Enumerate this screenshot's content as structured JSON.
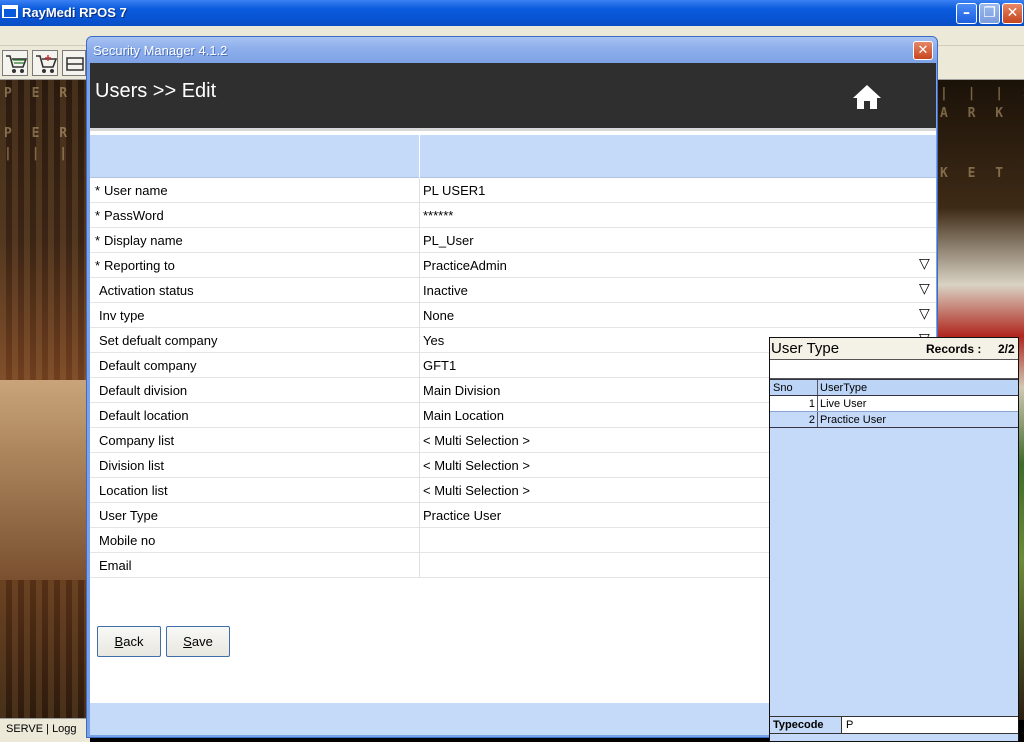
{
  "outer_window": {
    "title": "RayMedi RPOS 7",
    "status_text": "SERVE |  Logg"
  },
  "background": {
    "signage_text": [
      "P E R M A",
      "P E R M A",
      "| | | S U",
      "| | | S U P",
      "A R K E T",
      "K E T"
    ]
  },
  "dialog": {
    "title": "Security Manager 4.1.2",
    "breadcrumb": "Users >> Edit",
    "fields": [
      {
        "label": "User name",
        "value": "PL USER1",
        "required": true,
        "dropdown": false
      },
      {
        "label": "PassWord",
        "value": "******",
        "required": true,
        "dropdown": false
      },
      {
        "label": "Display name",
        "value": "PL_User",
        "required": true,
        "dropdown": false
      },
      {
        "label": "Reporting to",
        "value": "PracticeAdmin",
        "required": true,
        "dropdown": true
      },
      {
        "label": "Activation status",
        "value": "Inactive",
        "required": false,
        "dropdown": true
      },
      {
        "label": "Inv type",
        "value": "None",
        "required": false,
        "dropdown": true
      },
      {
        "label": "Set defualt company",
        "value": "Yes",
        "required": false,
        "dropdown": true
      },
      {
        "label": "Default company",
        "value": "GFT1",
        "required": false,
        "dropdown": false
      },
      {
        "label": "Default division",
        "value": "Main Division",
        "required": false,
        "dropdown": false
      },
      {
        "label": "Default location",
        "value": "Main Location",
        "required": false,
        "dropdown": false
      },
      {
        "label": "Company list",
        "value": "< Multi Selection >",
        "required": false,
        "dropdown": false
      },
      {
        "label": "Division list",
        "value": "< Multi Selection >",
        "required": false,
        "dropdown": false
      },
      {
        "label": "Location list",
        "value": "< Multi Selection >",
        "required": false,
        "dropdown": false
      },
      {
        "label": "User Type",
        "value": "Practice User",
        "required": false,
        "dropdown": false
      },
      {
        "label": "Mobile no",
        "value": "",
        "required": false,
        "dropdown": false
      },
      {
        "label": "Email",
        "value": "",
        "required": false,
        "dropdown": false
      }
    ],
    "required_marker": "*",
    "dropdown_glyph": "▽",
    "back_button": {
      "mnemonic": "B",
      "rest": "ack"
    },
    "save_button": {
      "mnemonic": "S",
      "rest": "ave"
    },
    "close_glyph": "✕"
  },
  "lookup": {
    "title": "User Type",
    "records_label": "Records :",
    "records_value": "2/2",
    "columns": [
      "Sno",
      "UserType"
    ],
    "rows": [
      {
        "sno": "1",
        "type": "Live User",
        "selected": false
      },
      {
        "sno": "2",
        "type": "Practice User",
        "selected": true
      }
    ],
    "typecode_label": "Typecode",
    "typecode_value": "P"
  },
  "colors": {
    "xp_blue": "#0a5bdc",
    "dialog_frame": "#7aa2e8",
    "header_band": "#2f2f2f",
    "light_blue": "#c5daf8"
  }
}
